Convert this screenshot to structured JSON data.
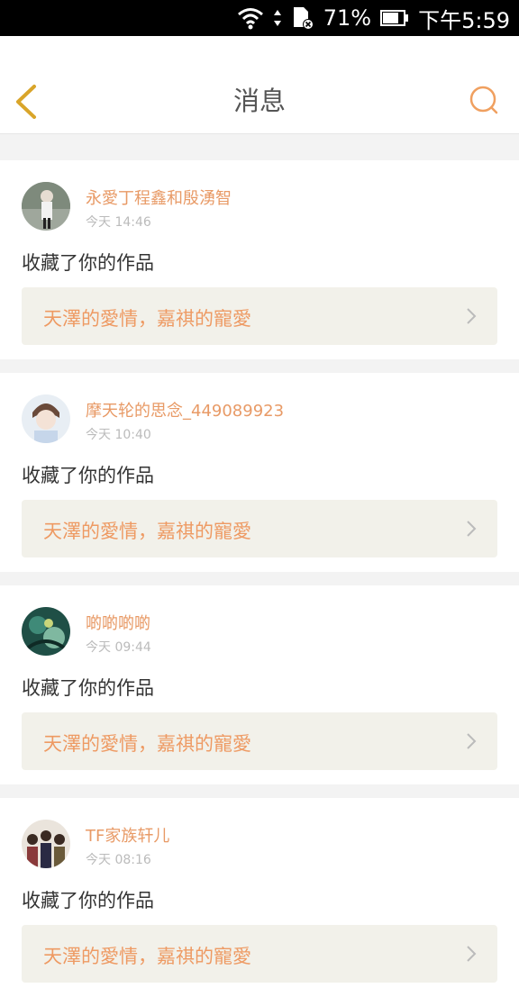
{
  "status_bar": {
    "battery": "71%",
    "time": "下午5:59"
  },
  "header": {
    "title": "消息"
  },
  "messages": [
    {
      "username": "永愛丁程鑫和殷湧智",
      "time": "今天 14:46",
      "action": "收藏了你的作品",
      "work_title": "天澤的愛情，嘉祺的寵愛",
      "avatar_color": "#8a9a8a"
    },
    {
      "username": "摩天轮的思念_449089923",
      "time": "今天 10:40",
      "action": "收藏了你的作品",
      "work_title": "天澤的愛情，嘉祺的寵愛",
      "avatar_color": "#c9d4e0"
    },
    {
      "username": "啲啲啲啲",
      "time": "今天 09:44",
      "action": "收藏了你的作品",
      "work_title": "天澤的愛情，嘉祺的寵愛",
      "avatar_color": "#2f6a5c"
    },
    {
      "username": "TF家族轩儿",
      "time": "今天 08:16",
      "action": "收藏了你的作品",
      "work_title": "天澤的愛情，嘉祺的寵愛",
      "avatar_color": "#6b4a3a"
    }
  ],
  "colors": {
    "accent": "#e89a66",
    "back_icon": "#d9a52a"
  }
}
